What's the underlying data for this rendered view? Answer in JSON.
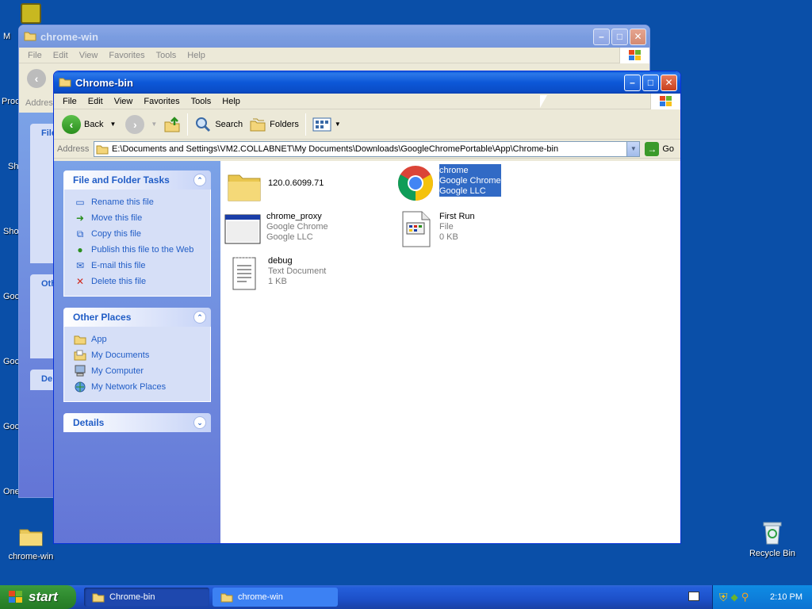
{
  "desktop": {
    "left_labels": [
      "M",
      "Proc",
      "Sh",
      "Sho",
      "Goc",
      "Goc",
      "Goc",
      "One"
    ],
    "icons": [
      {
        "label": "chrome-win"
      },
      {
        "label": "Recycle Bin"
      }
    ]
  },
  "back_window": {
    "title": "chrome-win",
    "menu": [
      "File",
      "Edit",
      "View",
      "Favorites",
      "Tools",
      "Help"
    ],
    "address_label": "Addres",
    "panel_labels": [
      "File",
      "Oth",
      "De"
    ]
  },
  "front_window": {
    "title": "Chrome-bin",
    "menu": [
      "File",
      "Edit",
      "View",
      "Favorites",
      "Tools",
      "Help"
    ],
    "toolbar": {
      "back": "Back",
      "search": "Search",
      "folders": "Folders"
    },
    "address": {
      "label": "Address",
      "value": "E:\\Documents and Settings\\VM2.COLLABNET\\My Documents\\Downloads\\GoogleChromePortable\\App\\Chrome-bin",
      "go": "Go"
    },
    "file_tasks": {
      "title": "File and Folder Tasks",
      "items": [
        "Rename this file",
        "Move this file",
        "Copy this file",
        "Publish this file to the Web",
        "E-mail this file",
        "Delete this file"
      ]
    },
    "other_places": {
      "title": "Other Places",
      "items": [
        "App",
        "My Documents",
        "My Computer",
        "My Network Places"
      ]
    },
    "details": {
      "title": "Details"
    },
    "files": [
      {
        "name": "120.0.6099.71",
        "line2": "",
        "line3": "",
        "icon": "folder-icon"
      },
      {
        "name": "chrome",
        "line2": "Google Chrome",
        "line3": "Google LLC",
        "icon": "chrome-icon",
        "selected": true
      },
      {
        "name": "chrome_proxy",
        "line2": "Google Chrome",
        "line3": "Google LLC",
        "icon": "app-window-icon"
      },
      {
        "name": "First Run",
        "line2": "File",
        "line3": "0 KB",
        "icon": "generic-file-icon"
      },
      {
        "name": "debug",
        "line2": "Text Document",
        "line3": "1 KB",
        "icon": "notepad-icon"
      }
    ]
  },
  "taskbar": {
    "start": "start",
    "tasks": [
      "Chrome-bin",
      "chrome-win"
    ],
    "clock": "2:10 PM"
  }
}
